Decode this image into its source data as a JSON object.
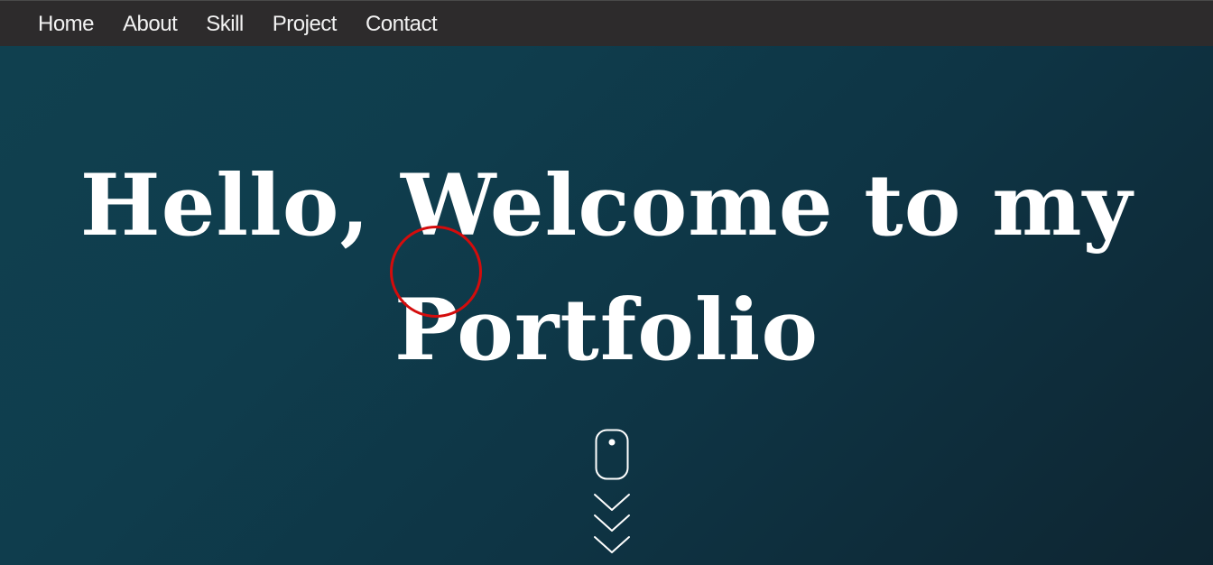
{
  "nav": {
    "items": [
      {
        "label": "Home"
      },
      {
        "label": "About"
      },
      {
        "label": "Skill"
      },
      {
        "label": "Project"
      },
      {
        "label": "Contact"
      }
    ]
  },
  "hero": {
    "title_line1": "Hello, Welcome to my",
    "title_line2": "Portfolio"
  },
  "icons": {
    "scroll": "mouse-scroll-icon",
    "chevrons": "chevron-down-icon",
    "cursor": "cursor-highlight"
  },
  "colors": {
    "navbar_bg": "#2d2b2c",
    "hero_bg": "#0f3d4d",
    "text": "#ffffff",
    "cursor_ring": "#d40c0c"
  }
}
